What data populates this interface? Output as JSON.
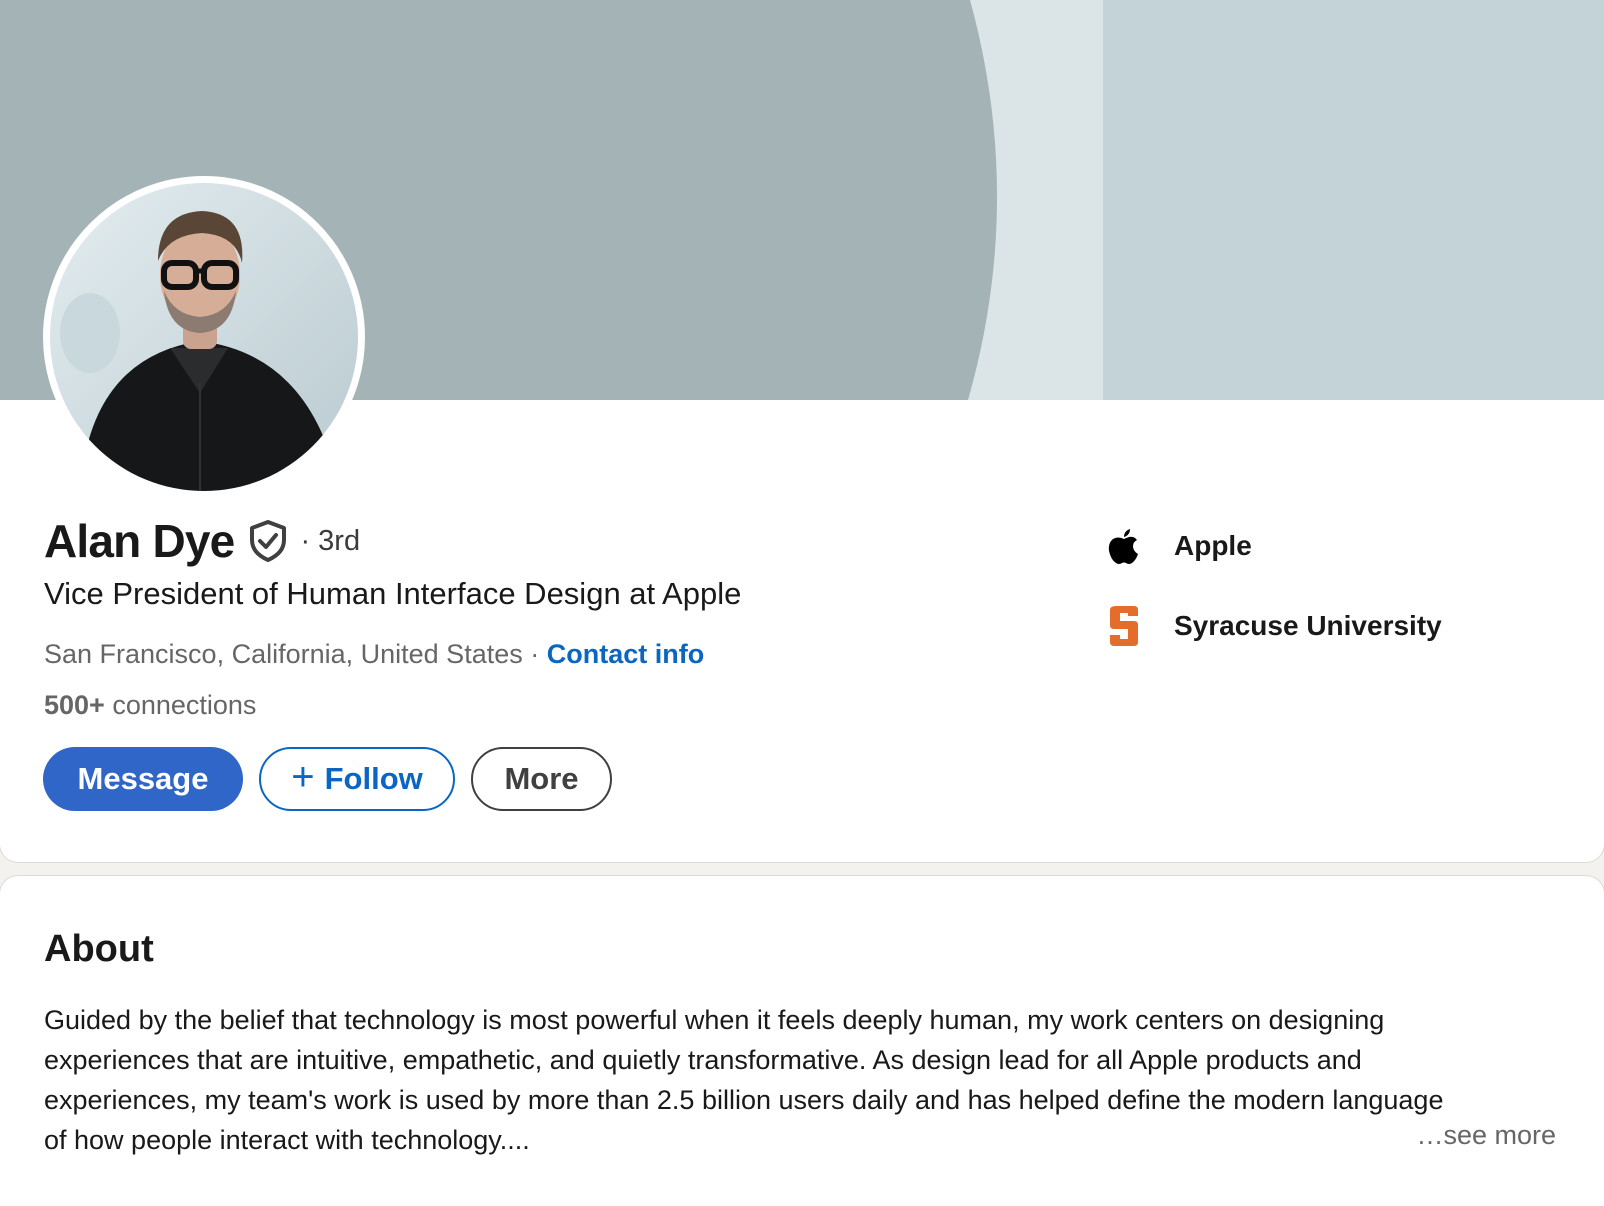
{
  "profile": {
    "name": "Alan Dye",
    "degree": "· 3rd",
    "headline": "Vice President of Human Interface Design at Apple",
    "location": "San Francisco, California, United States",
    "location_separator": " · ",
    "contact_info_label": "Contact info",
    "connections_count": "500+",
    "connections_label": " connections"
  },
  "actions": {
    "message_label": "Message",
    "follow_icon": "+",
    "follow_label": "Follow",
    "more_label": "More"
  },
  "organizations": [
    {
      "name": "Apple",
      "icon": "apple-logo-icon"
    },
    {
      "name": "Syracuse University",
      "icon": "syracuse-s-logo-icon"
    }
  ],
  "about": {
    "title": "About",
    "lines": [
      "Guided by the belief that technology is most powerful when it feels deeply human, my work centers on designing",
      "experiences that are intuitive, empathetic, and quietly transformative. As design lead for all Apple products and",
      "experiences, my team's work is used by more than 2.5 billion users daily and has helped define the modern language",
      "of how people interact with technology...."
    ],
    "see_more_label": "…see more"
  },
  "colors": {
    "brand_blue": "#0a66c2",
    "message_button": "#2f66c7",
    "banner_dark": "#a4b3b6",
    "banner_light": "#dbe4e6",
    "banner_right": "#c3d3d7",
    "syracuse_orange": "#e56d2b"
  }
}
